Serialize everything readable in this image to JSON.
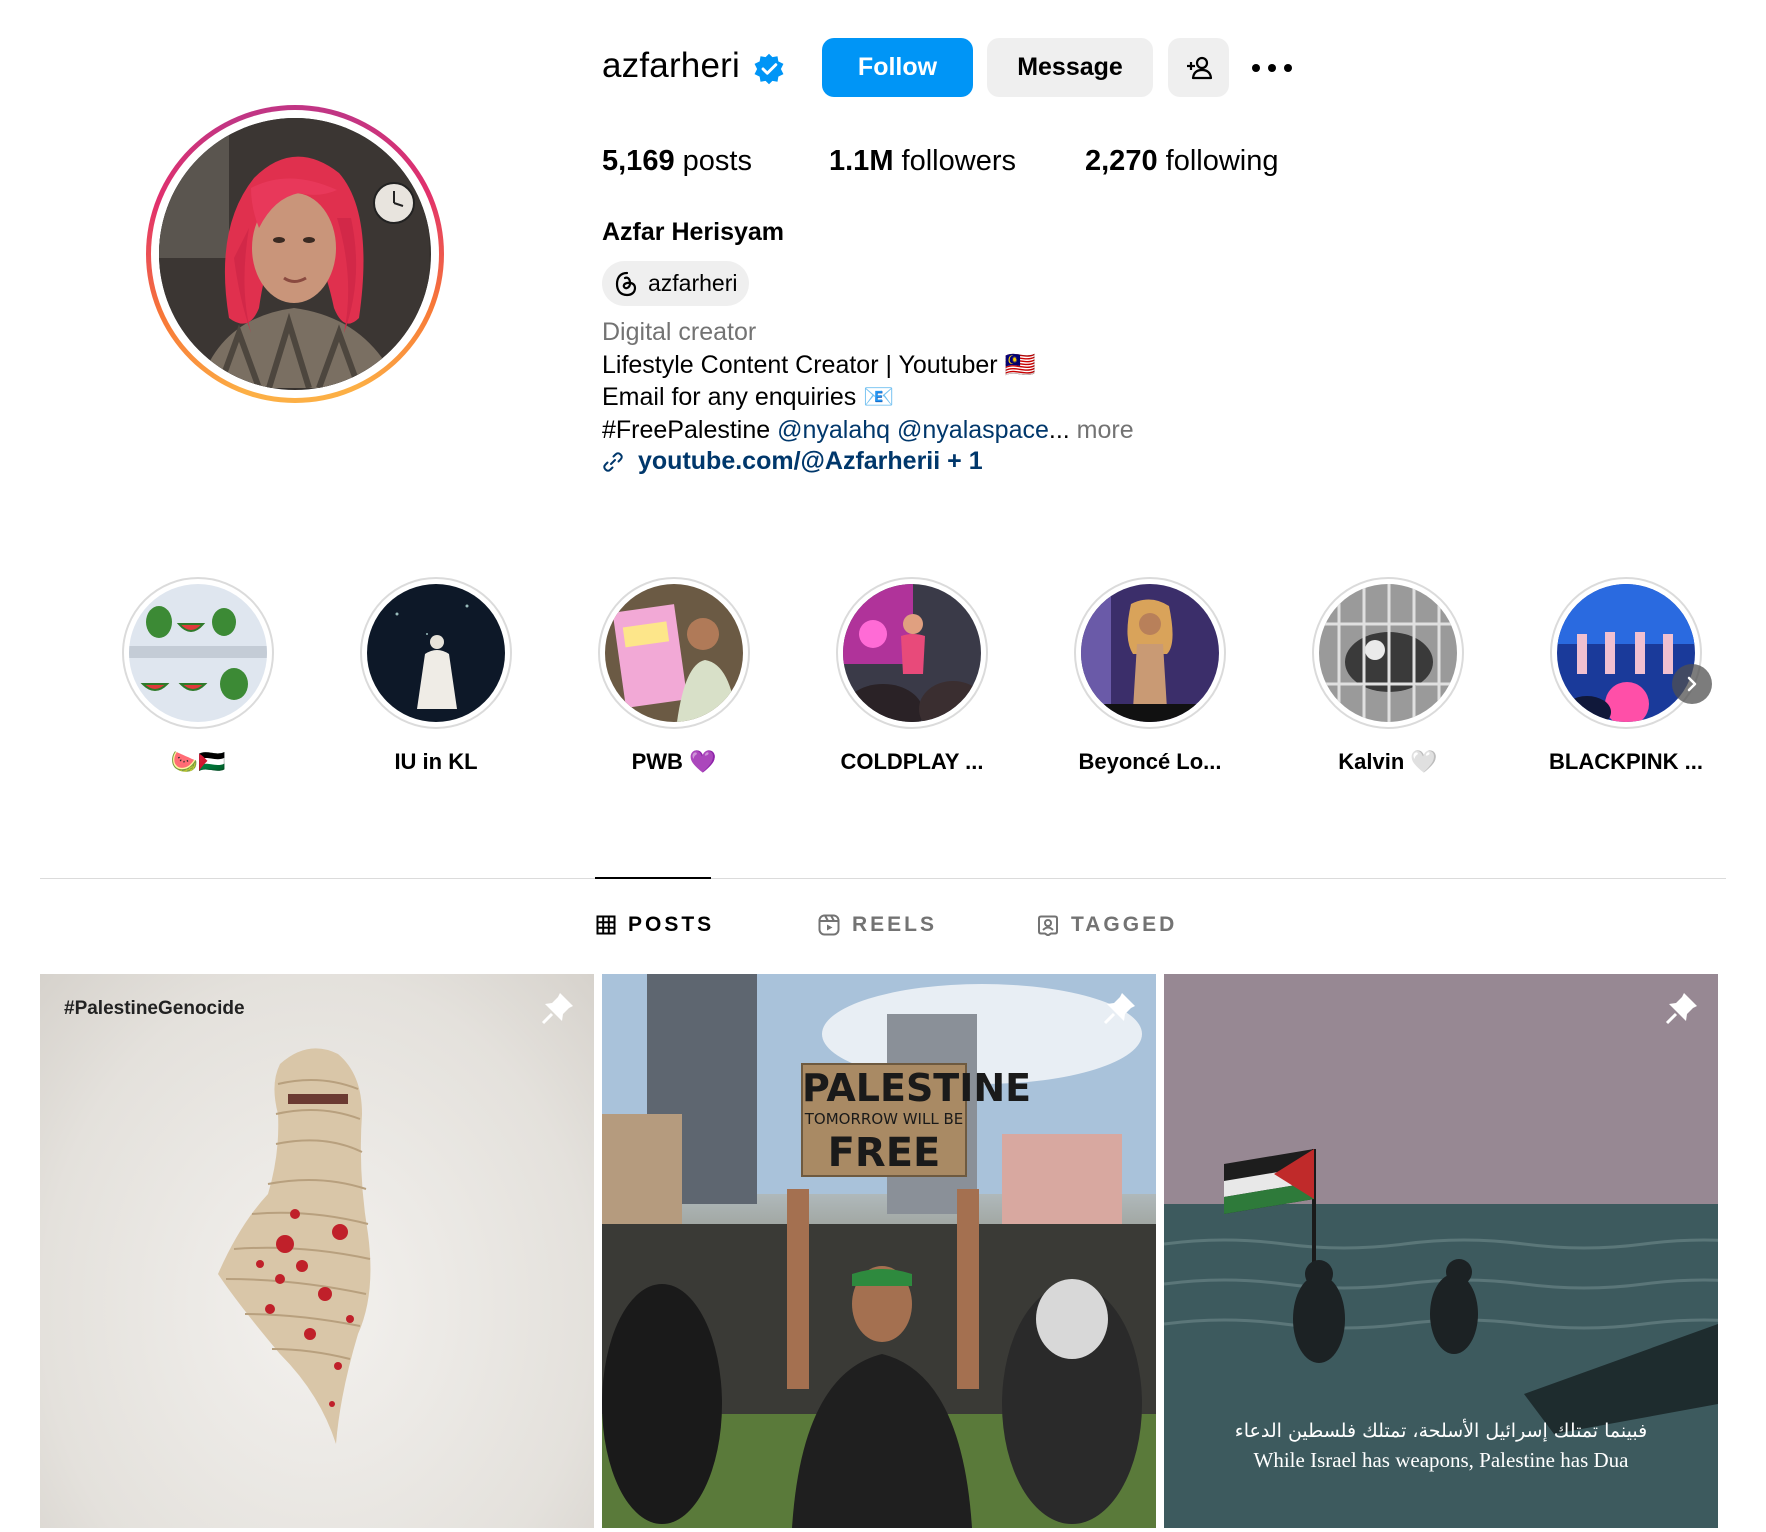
{
  "profile": {
    "username": "azfarheri",
    "follow_label": "Follow",
    "message_label": "Message",
    "stats": {
      "posts_count": "5,169",
      "posts_label": "posts",
      "followers_count": "1.1M",
      "followers_label": "followers",
      "following_count": "2,270",
      "following_label": "following"
    },
    "full_name": "Azfar Herisyam",
    "threads_handle": "azfarheri",
    "category": "Digital creator",
    "bio_line1": "Lifestyle Content Creator | Youtuber 🇲🇾",
    "bio_line2": "Email for any enquiries 📧",
    "bio_line3_tag": "#FreePalestine",
    "bio_line3_mention1": "@nyalahq",
    "bio_line3_mention2": "@nyalaspace",
    "bio_line3_ellipsis": "...",
    "bio_more": "more",
    "link_text": "youtube.com/@Azfarherii + 1"
  },
  "highlights": [
    {
      "label": "🍉🇵🇸"
    },
    {
      "label": "IU in KL"
    },
    {
      "label": "PWB 💜"
    },
    {
      "label": "COLDPLAY ..."
    },
    {
      "label": "Beyoncé Lo..."
    },
    {
      "label": "Kalvin 🤍"
    },
    {
      "label": "BLACKPINK ..."
    }
  ],
  "tabs": {
    "posts": "POSTS",
    "reels": "REELS",
    "tagged": "TAGGED"
  },
  "posts": [
    {
      "caption_tag": "#PalestineGenocide"
    },
    {
      "sign_line1": "PALESTINE",
      "sign_line2": "TOMORROW WILL BE",
      "sign_line3": "FREE"
    },
    {
      "arabic_text": "فبينما تمتلك إسرائيل الأسلحة، تمتلك فلسطين الدعاء",
      "english_text": "While Israel has weapons, Palestine has Dua"
    }
  ],
  "colors": {
    "follow_button": "#0095f6",
    "secondary_button": "#efefef",
    "link": "#00376b",
    "muted": "#737373",
    "verified": "#0095f6"
  }
}
